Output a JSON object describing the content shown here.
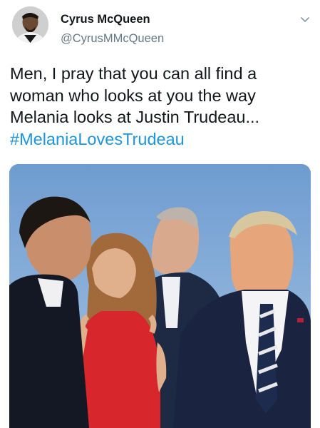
{
  "author": {
    "display_name": "Cyrus McQueen",
    "handle": "@CyrusMMcQueen",
    "avatar_icon": "profile-photo",
    "menu_icon": "chevron-down-icon"
  },
  "tweet": {
    "lines": [
      "Men, I pray that you can all find a",
      "woman who looks at you the way",
      "Melania looks at Justin Trudeau..."
    ],
    "hashtag": "#MelaniaLovesTrudeau"
  },
  "media": {
    "kind": "photo"
  },
  "colors": {
    "text": "#14171a",
    "secondary": "#657786",
    "link": "#1b95e0"
  }
}
